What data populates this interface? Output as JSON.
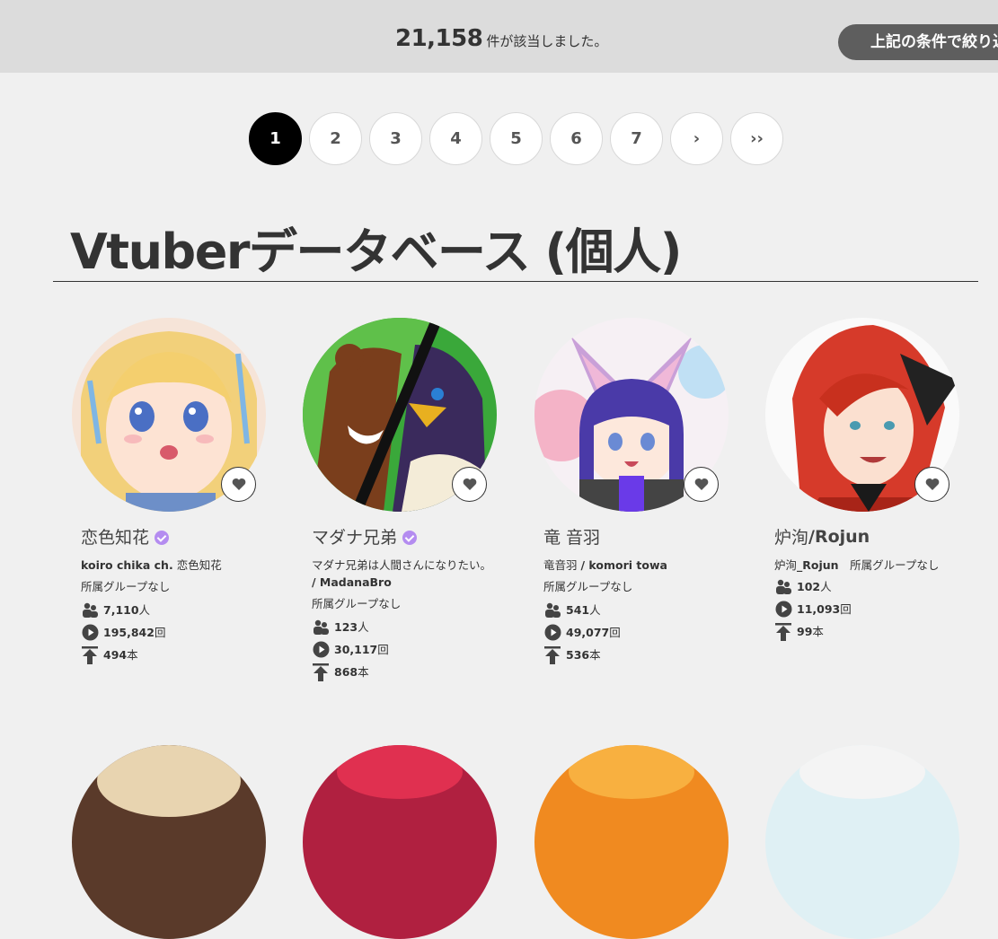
{
  "result": {
    "count": "21,158",
    "suffix": "件が該当しました。",
    "filter_button": "上記の条件で絞り込む"
  },
  "pagination": {
    "pages": [
      "1",
      "2",
      "3",
      "4",
      "5",
      "6",
      "7"
    ],
    "next": "›",
    "last": "››",
    "active": "1"
  },
  "title": "Vtuberデータベース (個人)",
  "cards": [
    {
      "name": "恋色知花",
      "name_bold": "",
      "verified": true,
      "sub_bold": "koiro chika ch.",
      "sub_plain": " 恋色知花",
      "sub_line2": "",
      "group": "所属グループなし",
      "subscribers": "7,110",
      "subscribers_unit": "人",
      "views": "195,842",
      "views_unit": "回",
      "videos": "494",
      "videos_unit": "本"
    },
    {
      "name": "マダナ兄弟",
      "name_bold": "",
      "verified": true,
      "sub_bold": "",
      "sub_plain": "マダナ兄弟は人間さんになりたい。",
      "sub_line2": "/ MadanaBro",
      "group": "所属グループなし",
      "subscribers": "123",
      "subscribers_unit": "人",
      "views": "30,117",
      "views_unit": "回",
      "videos": "868",
      "videos_unit": "本"
    },
    {
      "name": "竜 音羽",
      "name_bold": "",
      "verified": false,
      "sub_bold": "",
      "sub_plain": "竜音羽 ",
      "sub_bold2": "/ komori towa",
      "sub_line2": "",
      "group": "所属グループなし",
      "subscribers": "541",
      "subscribers_unit": "人",
      "views": "49,077",
      "views_unit": "回",
      "videos": "536",
      "videos_unit": "本"
    },
    {
      "name": "炉洵",
      "name_bold": "/Rojun",
      "verified": false,
      "sub_bold": "",
      "sub_plain": "炉洵",
      "sub_bold2": "_Rojun",
      "sub_after": "　所属グループなし",
      "sub_line2": "",
      "group": "",
      "subscribers": "102",
      "subscribers_unit": "人",
      "views": "11,093",
      "views_unit": "回",
      "videos": "99",
      "videos_unit": "本"
    }
  ],
  "icons": {
    "favorite": "heart-icon",
    "subscribers": "people-icon",
    "views": "play-icon",
    "videos": "upload-icon",
    "verified": "verified-check-icon"
  },
  "colors": {
    "verified": "#b48cf0",
    "active_page": "#000000",
    "filter_button": "#5e5e5e"
  }
}
